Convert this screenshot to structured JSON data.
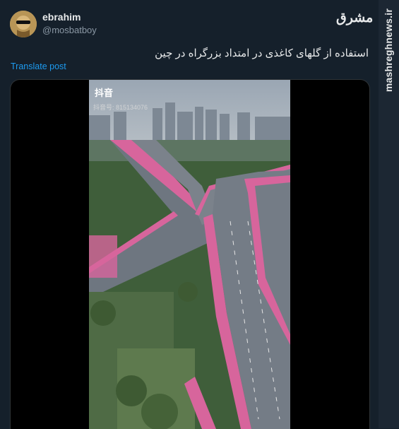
{
  "author": {
    "name": "ebrahim",
    "handle": "@mosbatboy"
  },
  "post": {
    "text": "استفاده از گلهای کاغذی در امتداد بزرگراه در چین",
    "translate_label": "Translate post"
  },
  "video": {
    "app_label": "抖音",
    "user_id": "抖音号: 815134076"
  },
  "watermark": {
    "logo_text": "مشرق",
    "site": "mashreghnews.ir"
  }
}
